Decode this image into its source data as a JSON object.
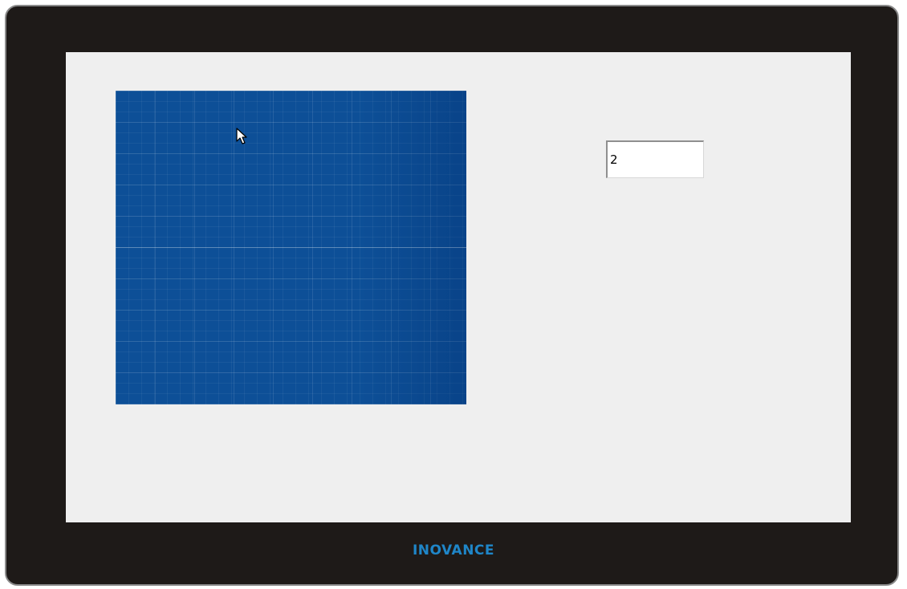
{
  "device": {
    "brand": "INOVANCE",
    "brand_color": "#1f86c8",
    "bezel_color": "#1e1a18"
  },
  "screen": {
    "background": "#efefef",
    "grid_panel": {
      "fill_color": "#0d4f97"
    },
    "numeric_input": {
      "value": "2"
    }
  },
  "cursor": {
    "icon": "mouse-pointer-icon"
  }
}
